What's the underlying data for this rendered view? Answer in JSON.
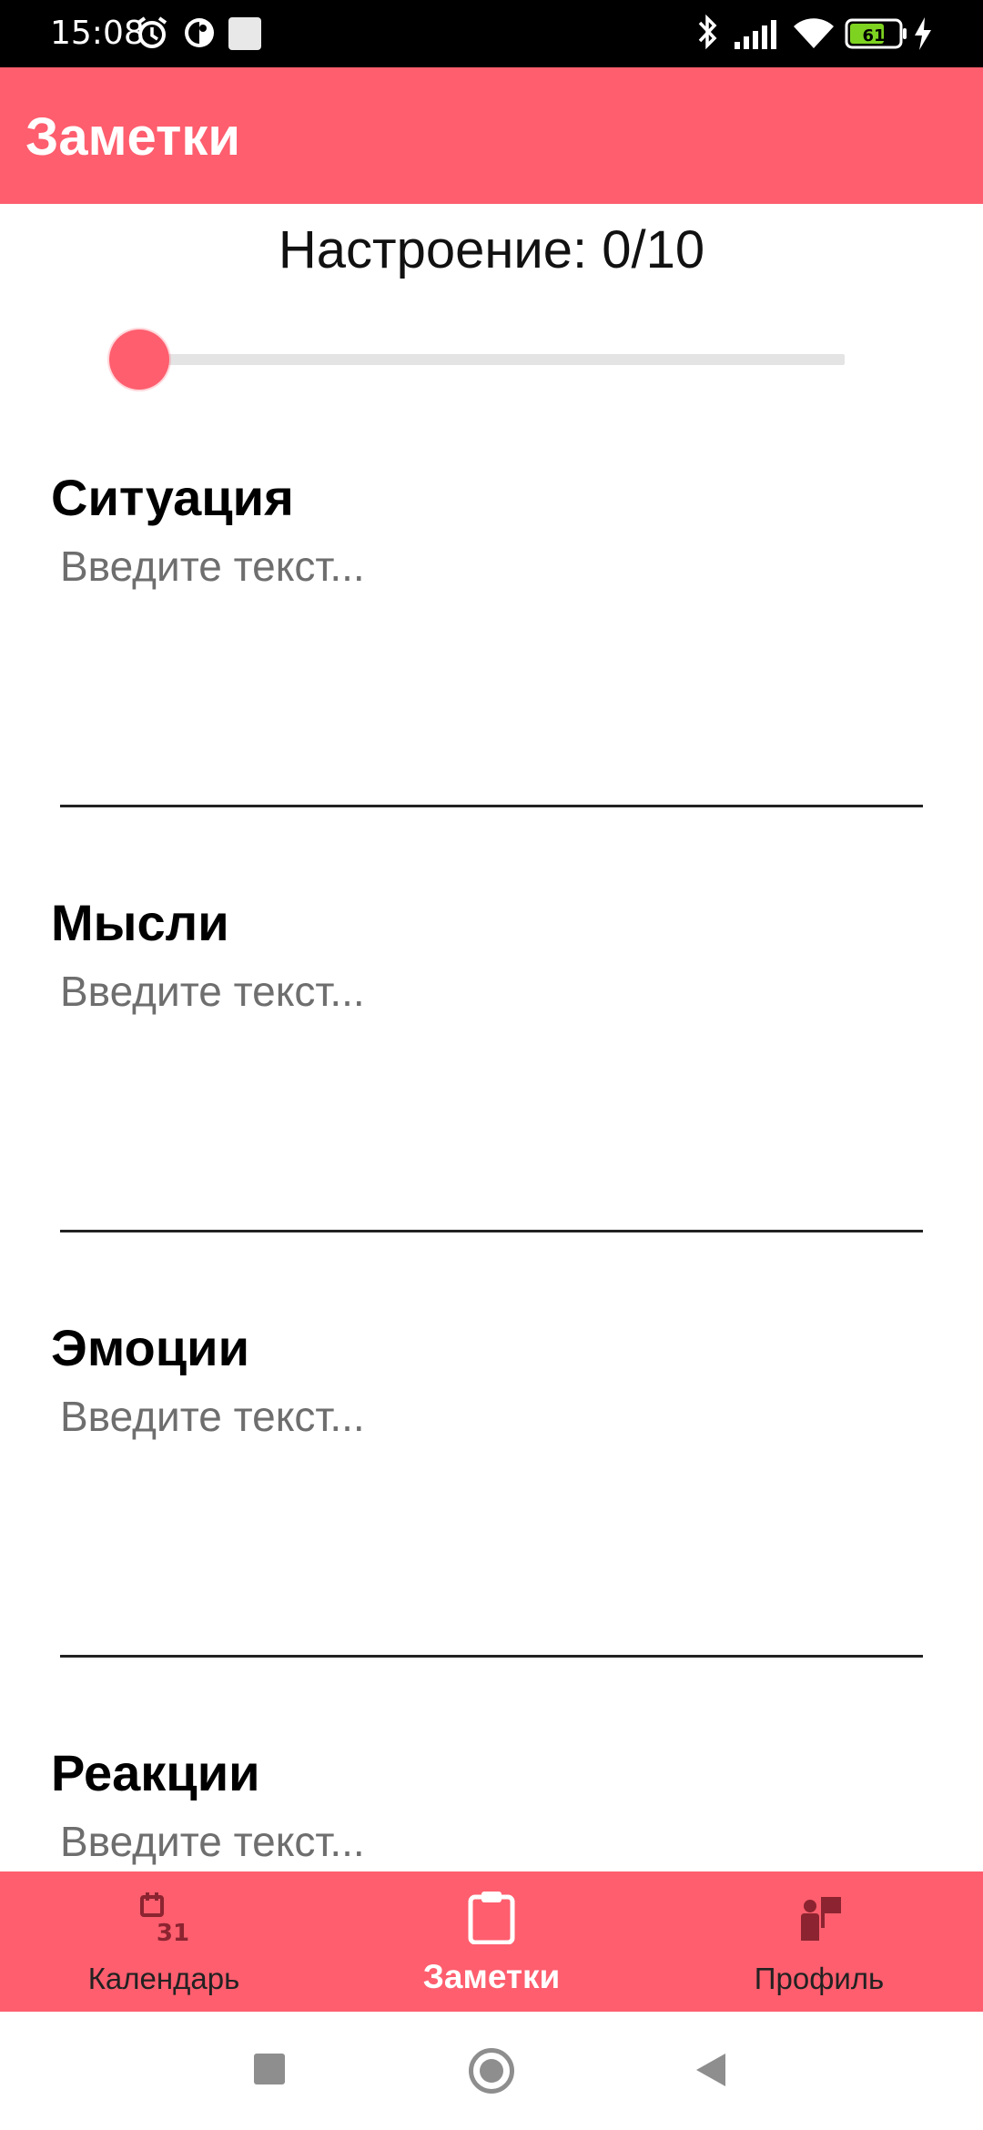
{
  "status_bar": {
    "time": "15:08",
    "battery": "61",
    "icons": [
      "alarm-icon",
      "dnd-icon",
      "notification-square-icon",
      "bluetooth-icon",
      "signal-icon",
      "wifi-icon",
      "battery-icon",
      "charging-icon"
    ]
  },
  "app_bar": {
    "title": "Заметки",
    "color": "#fe5e6e"
  },
  "mood": {
    "label": "Настроение: 0/10",
    "value": 0,
    "max": 10
  },
  "sections": [
    {
      "heading": "Ситуация",
      "placeholder": "Введите текст..."
    },
    {
      "heading": "Мысли",
      "placeholder": "Введите текст..."
    },
    {
      "heading": "Эмоции",
      "placeholder": "Введите текст..."
    },
    {
      "heading": "Реакции",
      "placeholder": "Введите текст..."
    }
  ],
  "bottom_nav": {
    "items": [
      {
        "label": "Календарь",
        "icon": "calendar-icon",
        "active": false
      },
      {
        "label": "Заметки",
        "icon": "clipboard-icon",
        "active": true
      },
      {
        "label": "Профиль",
        "icon": "profile-icon",
        "active": false
      }
    ]
  },
  "system_nav": {
    "icons": [
      "recent-apps-icon",
      "home-icon",
      "back-icon"
    ]
  },
  "colors": {
    "accent": "#fe5e6e",
    "nav_icon": "#8b2430"
  }
}
